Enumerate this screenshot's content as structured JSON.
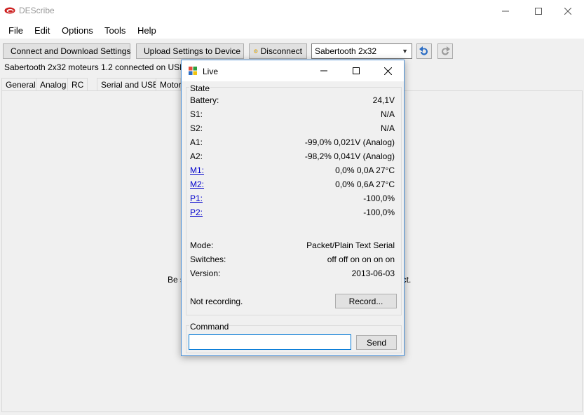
{
  "window": {
    "title": "DEScribe"
  },
  "menu": [
    "File",
    "Edit",
    "Options",
    "Tools",
    "Help"
  ],
  "toolbar": {
    "connect_label": "Connect and Download Settings",
    "upload_label": "Upload Settings to Device",
    "disconnect_label": "Disconnect",
    "device_selected": "Sabertooth 2x32"
  },
  "status": "Sabertooth 2x32 moteurs 1.2 connected on USB.",
  "tabs": [
    "General",
    "Analog",
    "RC",
    "Serial and USB",
    "Motor"
  ],
  "content": {
    "partial_left": "Be s",
    "partial_right": "ect."
  },
  "live": {
    "title": "Live",
    "state_label": "State",
    "rows": [
      {
        "label": "Battery:",
        "value": "24,1V",
        "link": false
      },
      {
        "label": "S1:",
        "value": "N/A",
        "link": false
      },
      {
        "label": "S2:",
        "value": "N/A",
        "link": false
      },
      {
        "label": "A1:",
        "value": "-99,0% 0,021V  (Analog)",
        "link": false
      },
      {
        "label": "A2:",
        "value": "-98,2% 0,041V  (Analog)",
        "link": false
      },
      {
        "label": "M1:",
        "value": "0,0% 0,0A 27°C",
        "link": true
      },
      {
        "label": "M2:",
        "value": "0,0% 0,6A 27°C",
        "link": true
      },
      {
        "label": "P1:",
        "value": "-100,0%",
        "link": true
      },
      {
        "label": "P2:",
        "value": "-100,0%",
        "link": true
      }
    ],
    "info": [
      {
        "label": "Mode:",
        "value": "Packet/Plain Text Serial"
      },
      {
        "label": "Switches:",
        "value": "off off on on on on"
      },
      {
        "label": "Version:",
        "value": "2013-06-03"
      }
    ],
    "recording_status": "Not recording.",
    "record_label": "Record...",
    "command_label": "Command",
    "command_value": "",
    "send_label": "Send"
  },
  "colors": {
    "accent": "#0078d7",
    "link": "#0000cc",
    "dialog_border": "#4b90d6"
  }
}
